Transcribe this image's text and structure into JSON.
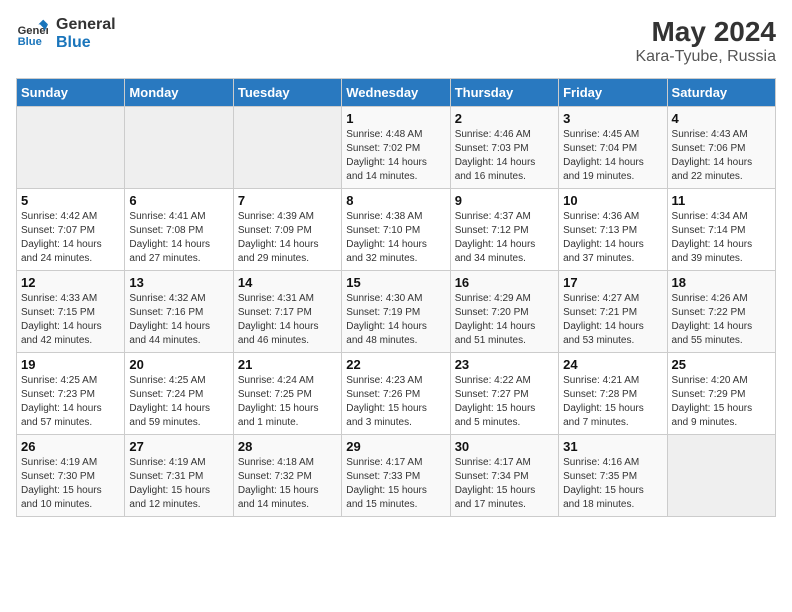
{
  "header": {
    "logo_line1": "General",
    "logo_line2": "Blue",
    "title": "May 2024",
    "subtitle": "Kara-Tyube, Russia"
  },
  "weekdays": [
    "Sunday",
    "Monday",
    "Tuesday",
    "Wednesday",
    "Thursday",
    "Friday",
    "Saturday"
  ],
  "weeks": [
    [
      {
        "day": "",
        "info": ""
      },
      {
        "day": "",
        "info": ""
      },
      {
        "day": "",
        "info": ""
      },
      {
        "day": "1",
        "info": "Sunrise: 4:48 AM\nSunset: 7:02 PM\nDaylight: 14 hours and 14 minutes."
      },
      {
        "day": "2",
        "info": "Sunrise: 4:46 AM\nSunset: 7:03 PM\nDaylight: 14 hours and 16 minutes."
      },
      {
        "day": "3",
        "info": "Sunrise: 4:45 AM\nSunset: 7:04 PM\nDaylight: 14 hours and 19 minutes."
      },
      {
        "day": "4",
        "info": "Sunrise: 4:43 AM\nSunset: 7:06 PM\nDaylight: 14 hours and 22 minutes."
      }
    ],
    [
      {
        "day": "5",
        "info": "Sunrise: 4:42 AM\nSunset: 7:07 PM\nDaylight: 14 hours and 24 minutes."
      },
      {
        "day": "6",
        "info": "Sunrise: 4:41 AM\nSunset: 7:08 PM\nDaylight: 14 hours and 27 minutes."
      },
      {
        "day": "7",
        "info": "Sunrise: 4:39 AM\nSunset: 7:09 PM\nDaylight: 14 hours and 29 minutes."
      },
      {
        "day": "8",
        "info": "Sunrise: 4:38 AM\nSunset: 7:10 PM\nDaylight: 14 hours and 32 minutes."
      },
      {
        "day": "9",
        "info": "Sunrise: 4:37 AM\nSunset: 7:12 PM\nDaylight: 14 hours and 34 minutes."
      },
      {
        "day": "10",
        "info": "Sunrise: 4:36 AM\nSunset: 7:13 PM\nDaylight: 14 hours and 37 minutes."
      },
      {
        "day": "11",
        "info": "Sunrise: 4:34 AM\nSunset: 7:14 PM\nDaylight: 14 hours and 39 minutes."
      }
    ],
    [
      {
        "day": "12",
        "info": "Sunrise: 4:33 AM\nSunset: 7:15 PM\nDaylight: 14 hours and 42 minutes."
      },
      {
        "day": "13",
        "info": "Sunrise: 4:32 AM\nSunset: 7:16 PM\nDaylight: 14 hours and 44 minutes."
      },
      {
        "day": "14",
        "info": "Sunrise: 4:31 AM\nSunset: 7:17 PM\nDaylight: 14 hours and 46 minutes."
      },
      {
        "day": "15",
        "info": "Sunrise: 4:30 AM\nSunset: 7:19 PM\nDaylight: 14 hours and 48 minutes."
      },
      {
        "day": "16",
        "info": "Sunrise: 4:29 AM\nSunset: 7:20 PM\nDaylight: 14 hours and 51 minutes."
      },
      {
        "day": "17",
        "info": "Sunrise: 4:27 AM\nSunset: 7:21 PM\nDaylight: 14 hours and 53 minutes."
      },
      {
        "day": "18",
        "info": "Sunrise: 4:26 AM\nSunset: 7:22 PM\nDaylight: 14 hours and 55 minutes."
      }
    ],
    [
      {
        "day": "19",
        "info": "Sunrise: 4:25 AM\nSunset: 7:23 PM\nDaylight: 14 hours and 57 minutes."
      },
      {
        "day": "20",
        "info": "Sunrise: 4:25 AM\nSunset: 7:24 PM\nDaylight: 14 hours and 59 minutes."
      },
      {
        "day": "21",
        "info": "Sunrise: 4:24 AM\nSunset: 7:25 PM\nDaylight: 15 hours and 1 minute."
      },
      {
        "day": "22",
        "info": "Sunrise: 4:23 AM\nSunset: 7:26 PM\nDaylight: 15 hours and 3 minutes."
      },
      {
        "day": "23",
        "info": "Sunrise: 4:22 AM\nSunset: 7:27 PM\nDaylight: 15 hours and 5 minutes."
      },
      {
        "day": "24",
        "info": "Sunrise: 4:21 AM\nSunset: 7:28 PM\nDaylight: 15 hours and 7 minutes."
      },
      {
        "day": "25",
        "info": "Sunrise: 4:20 AM\nSunset: 7:29 PM\nDaylight: 15 hours and 9 minutes."
      }
    ],
    [
      {
        "day": "26",
        "info": "Sunrise: 4:19 AM\nSunset: 7:30 PM\nDaylight: 15 hours and 10 minutes."
      },
      {
        "day": "27",
        "info": "Sunrise: 4:19 AM\nSunset: 7:31 PM\nDaylight: 15 hours and 12 minutes."
      },
      {
        "day": "28",
        "info": "Sunrise: 4:18 AM\nSunset: 7:32 PM\nDaylight: 15 hours and 14 minutes."
      },
      {
        "day": "29",
        "info": "Sunrise: 4:17 AM\nSunset: 7:33 PM\nDaylight: 15 hours and 15 minutes."
      },
      {
        "day": "30",
        "info": "Sunrise: 4:17 AM\nSunset: 7:34 PM\nDaylight: 15 hours and 17 minutes."
      },
      {
        "day": "31",
        "info": "Sunrise: 4:16 AM\nSunset: 7:35 PM\nDaylight: 15 hours and 18 minutes."
      },
      {
        "day": "",
        "info": ""
      }
    ]
  ]
}
